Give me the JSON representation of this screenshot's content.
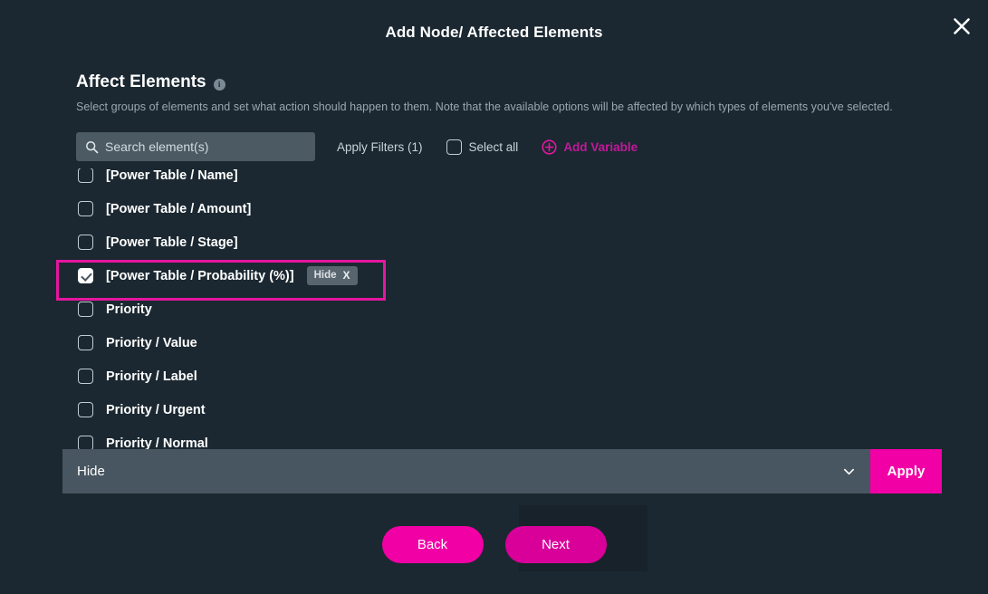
{
  "modal": {
    "title": "Add Node/ Affected Elements",
    "close_icon": "close-icon"
  },
  "section": {
    "title": "Affect Elements",
    "info_icon": "info-icon",
    "info_glyph": "i",
    "description": "Select groups of elements and set what action should happen to them. Note that the available options will be affected by which types of elements you've selected."
  },
  "toolbar": {
    "search": {
      "icon": "search-icon",
      "placeholder": "Search element(s)",
      "value": ""
    },
    "apply_filters_label": "Apply Filters (1)",
    "select_all_label": "Select all",
    "select_all_checked": false,
    "add_variable_label": "Add Variable",
    "add_variable_icon": "plus-circle-icon"
  },
  "element_list": {
    "rows": [
      {
        "label": "[Power Table / Name]",
        "checked": false,
        "tag": null
      },
      {
        "label": "[Power Table / Amount]",
        "checked": false,
        "tag": null
      },
      {
        "label": "[Power Table / Stage]",
        "checked": false,
        "tag": null
      },
      {
        "label": "[Power Table / Probability (%)]",
        "checked": true,
        "tag": "Hide",
        "tag_close": "X"
      },
      {
        "label": "Priority",
        "checked": false,
        "tag": null
      },
      {
        "label": "Priority / Value",
        "checked": false,
        "tag": null
      },
      {
        "label": "Priority / Label",
        "checked": false,
        "tag": null
      },
      {
        "label": "Priority / Urgent",
        "checked": false,
        "tag": null
      },
      {
        "label": "Priority / Normal",
        "checked": false,
        "tag": null
      }
    ],
    "highlighted_row_index": 3
  },
  "action_bar": {
    "selected_action": "Hide",
    "chevron_icon": "chevron-down-icon",
    "apply_label": "Apply"
  },
  "footer": {
    "back_label": "Back",
    "next_label": "Next"
  },
  "colors": {
    "background": "#1b2831",
    "accent_magenta": "#f100a5",
    "highlight_ring": "#e5169f",
    "action_bar": "#475660",
    "search_field": "#4b5a63",
    "tag_badge": "#59656e",
    "muted_text": "#9aa7b0"
  }
}
